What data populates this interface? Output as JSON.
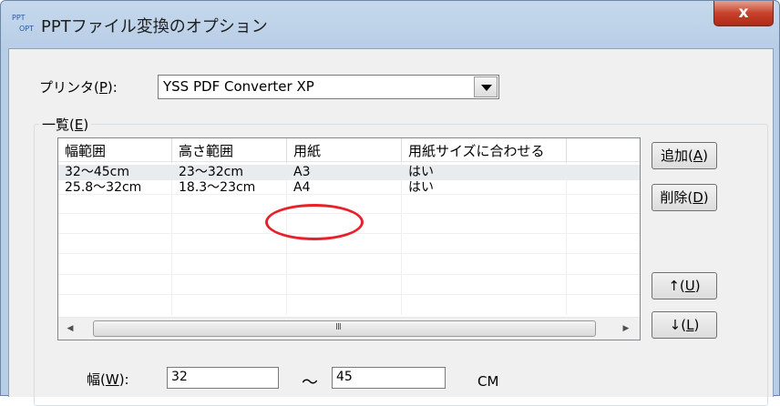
{
  "window": {
    "title": "PPTファイル変換のオプション",
    "icon_top": "PPT",
    "icon_bottom": "OPT",
    "close_glyph": "x"
  },
  "printer": {
    "label_prefix": "プリンタ(",
    "label_key": "P",
    "label_suffix": "):",
    "value": "YSS PDF Converter XP"
  },
  "list_group": {
    "prefix": "一覧(",
    "key": "E",
    "suffix": ")"
  },
  "table": {
    "columns": [
      "幅範囲",
      "高さ範囲",
      "用紙",
      "用紙サイズに合わせる"
    ],
    "rows": [
      [
        "32〜45cm",
        "23〜32cm",
        "A3",
        "はい"
      ],
      [
        "25.8〜32cm",
        "18.3〜23cm",
        "A4",
        "はい"
      ]
    ],
    "scroll_grip": "III"
  },
  "buttons": {
    "add": {
      "prefix": "追加(",
      "key": "A",
      "suffix": ")"
    },
    "delete": {
      "prefix": "削除(",
      "key": "D",
      "suffix": ")"
    },
    "up": {
      "prefix": "↑(",
      "key": "U",
      "suffix": ")"
    },
    "down": {
      "prefix": "↓(",
      "key": "L",
      "suffix": ")"
    }
  },
  "width_range": {
    "label_prefix": "幅(",
    "label_key": "W",
    "label_suffix": "):",
    "from": "32",
    "separator": "〜",
    "to": "45",
    "unit": "CM"
  },
  "colors": {
    "annotation": "#e8202a",
    "close_button": "#c7412c",
    "titlebar": "#c5d8ec"
  }
}
